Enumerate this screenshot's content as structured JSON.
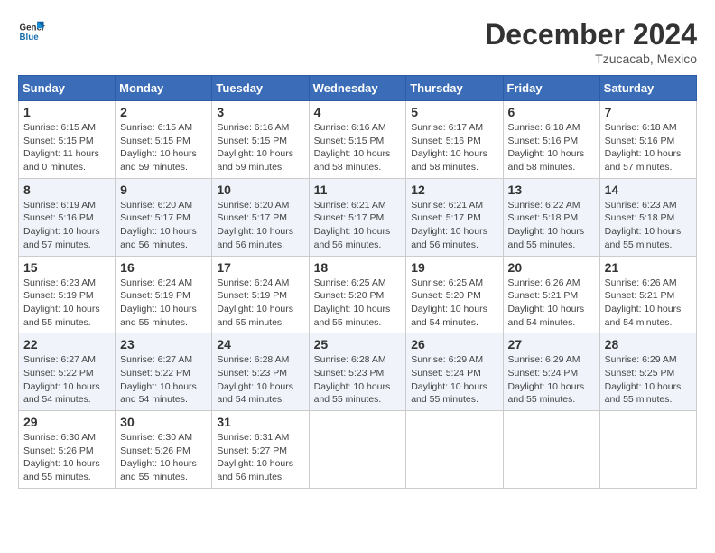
{
  "logo": {
    "name": "General",
    "name2": "Blue"
  },
  "header": {
    "month": "December 2024",
    "location": "Tzucacab, Mexico"
  },
  "weekdays": [
    "Sunday",
    "Monday",
    "Tuesday",
    "Wednesday",
    "Thursday",
    "Friday",
    "Saturday"
  ],
  "weeks": [
    [
      {
        "day": "1",
        "info": "Sunrise: 6:15 AM\nSunset: 5:15 PM\nDaylight: 11 hours\nand 0 minutes."
      },
      {
        "day": "2",
        "info": "Sunrise: 6:15 AM\nSunset: 5:15 PM\nDaylight: 10 hours\nand 59 minutes."
      },
      {
        "day": "3",
        "info": "Sunrise: 6:16 AM\nSunset: 5:15 PM\nDaylight: 10 hours\nand 59 minutes."
      },
      {
        "day": "4",
        "info": "Sunrise: 6:16 AM\nSunset: 5:15 PM\nDaylight: 10 hours\nand 58 minutes."
      },
      {
        "day": "5",
        "info": "Sunrise: 6:17 AM\nSunset: 5:16 PM\nDaylight: 10 hours\nand 58 minutes."
      },
      {
        "day": "6",
        "info": "Sunrise: 6:18 AM\nSunset: 5:16 PM\nDaylight: 10 hours\nand 58 minutes."
      },
      {
        "day": "7",
        "info": "Sunrise: 6:18 AM\nSunset: 5:16 PM\nDaylight: 10 hours\nand 57 minutes."
      }
    ],
    [
      {
        "day": "8",
        "info": "Sunrise: 6:19 AM\nSunset: 5:16 PM\nDaylight: 10 hours\nand 57 minutes."
      },
      {
        "day": "9",
        "info": "Sunrise: 6:20 AM\nSunset: 5:17 PM\nDaylight: 10 hours\nand 56 minutes."
      },
      {
        "day": "10",
        "info": "Sunrise: 6:20 AM\nSunset: 5:17 PM\nDaylight: 10 hours\nand 56 minutes."
      },
      {
        "day": "11",
        "info": "Sunrise: 6:21 AM\nSunset: 5:17 PM\nDaylight: 10 hours\nand 56 minutes."
      },
      {
        "day": "12",
        "info": "Sunrise: 6:21 AM\nSunset: 5:17 PM\nDaylight: 10 hours\nand 56 minutes."
      },
      {
        "day": "13",
        "info": "Sunrise: 6:22 AM\nSunset: 5:18 PM\nDaylight: 10 hours\nand 55 minutes."
      },
      {
        "day": "14",
        "info": "Sunrise: 6:23 AM\nSunset: 5:18 PM\nDaylight: 10 hours\nand 55 minutes."
      }
    ],
    [
      {
        "day": "15",
        "info": "Sunrise: 6:23 AM\nSunset: 5:19 PM\nDaylight: 10 hours\nand 55 minutes."
      },
      {
        "day": "16",
        "info": "Sunrise: 6:24 AM\nSunset: 5:19 PM\nDaylight: 10 hours\nand 55 minutes."
      },
      {
        "day": "17",
        "info": "Sunrise: 6:24 AM\nSunset: 5:19 PM\nDaylight: 10 hours\nand 55 minutes."
      },
      {
        "day": "18",
        "info": "Sunrise: 6:25 AM\nSunset: 5:20 PM\nDaylight: 10 hours\nand 55 minutes."
      },
      {
        "day": "19",
        "info": "Sunrise: 6:25 AM\nSunset: 5:20 PM\nDaylight: 10 hours\nand 54 minutes."
      },
      {
        "day": "20",
        "info": "Sunrise: 6:26 AM\nSunset: 5:21 PM\nDaylight: 10 hours\nand 54 minutes."
      },
      {
        "day": "21",
        "info": "Sunrise: 6:26 AM\nSunset: 5:21 PM\nDaylight: 10 hours\nand 54 minutes."
      }
    ],
    [
      {
        "day": "22",
        "info": "Sunrise: 6:27 AM\nSunset: 5:22 PM\nDaylight: 10 hours\nand 54 minutes."
      },
      {
        "day": "23",
        "info": "Sunrise: 6:27 AM\nSunset: 5:22 PM\nDaylight: 10 hours\nand 54 minutes."
      },
      {
        "day": "24",
        "info": "Sunrise: 6:28 AM\nSunset: 5:23 PM\nDaylight: 10 hours\nand 54 minutes."
      },
      {
        "day": "25",
        "info": "Sunrise: 6:28 AM\nSunset: 5:23 PM\nDaylight: 10 hours\nand 55 minutes."
      },
      {
        "day": "26",
        "info": "Sunrise: 6:29 AM\nSunset: 5:24 PM\nDaylight: 10 hours\nand 55 minutes."
      },
      {
        "day": "27",
        "info": "Sunrise: 6:29 AM\nSunset: 5:24 PM\nDaylight: 10 hours\nand 55 minutes."
      },
      {
        "day": "28",
        "info": "Sunrise: 6:29 AM\nSunset: 5:25 PM\nDaylight: 10 hours\nand 55 minutes."
      }
    ],
    [
      {
        "day": "29",
        "info": "Sunrise: 6:30 AM\nSunset: 5:26 PM\nDaylight: 10 hours\nand 55 minutes."
      },
      {
        "day": "30",
        "info": "Sunrise: 6:30 AM\nSunset: 5:26 PM\nDaylight: 10 hours\nand 55 minutes."
      },
      {
        "day": "31",
        "info": "Sunrise: 6:31 AM\nSunset: 5:27 PM\nDaylight: 10 hours\nand 56 minutes."
      },
      {
        "day": "",
        "info": ""
      },
      {
        "day": "",
        "info": ""
      },
      {
        "day": "",
        "info": ""
      },
      {
        "day": "",
        "info": ""
      }
    ]
  ]
}
